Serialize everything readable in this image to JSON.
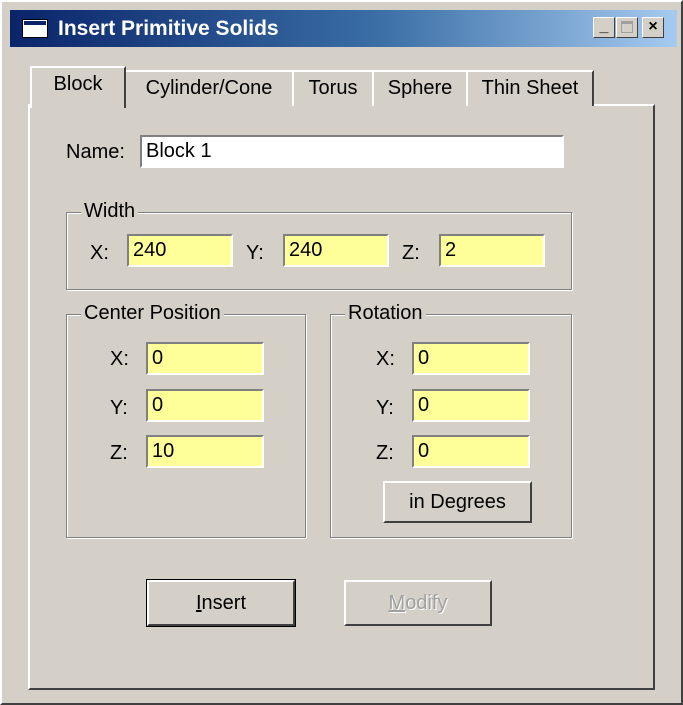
{
  "window": {
    "title": "Insert Primitive Solids",
    "minimize": "_",
    "close": "×"
  },
  "tabs": [
    {
      "label": "Block",
      "active": true
    },
    {
      "label": "Cylinder/Cone",
      "active": false
    },
    {
      "label": "Torus",
      "active": false
    },
    {
      "label": "Sphere",
      "active": false
    },
    {
      "label": "Thin Sheet",
      "active": false
    }
  ],
  "name": {
    "label": "Name:",
    "value": "Block 1"
  },
  "width": {
    "title": "Width",
    "x_label": "X:",
    "x_value": "240",
    "y_label": "Y:",
    "y_value": "240",
    "z_label": "Z:",
    "z_value": "2"
  },
  "center": {
    "title": "Center Position",
    "x_label": "X:",
    "x_value": "0",
    "y_label": "Y:",
    "y_value": "0",
    "z_label": "Z:",
    "z_value": "10"
  },
  "rotation": {
    "title": "Rotation",
    "x_label": "X:",
    "x_value": "0",
    "y_label": "Y:",
    "y_value": "0",
    "z_label": "Z:",
    "z_value": "0",
    "units_button": "in Degrees"
  },
  "buttons": {
    "insert_mnemonic": "I",
    "insert_rest": "nsert",
    "modify_mnemonic": "M",
    "modify_rest": "odify",
    "modify_enabled": false
  },
  "colors": {
    "face": "#d4d0c8",
    "title_start": "#0a246a",
    "title_end": "#a6caf0",
    "field_highlight": "#ffff99"
  }
}
